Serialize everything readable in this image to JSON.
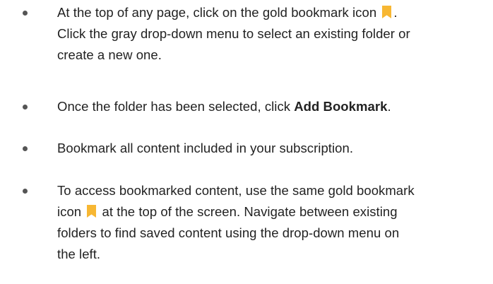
{
  "colors": {
    "bookmark_gold": "#F7B733",
    "bullet": "#555555",
    "text": "#222222"
  },
  "icons": {
    "bookmark": "bookmark-icon"
  },
  "list": {
    "item1": {
      "line1_before": "At the top of any page, click on the gold bookmark icon",
      "line1_after": ".",
      "line2": "Click the gray drop-down menu to select an existing folder or",
      "line3": "create a new one."
    },
    "item2": {
      "before": "Once the folder has been selected, click ",
      "bold": "Add Bookmark",
      "after": "."
    },
    "item3": {
      "text": "Bookmark all content included in your subscription."
    },
    "item4": {
      "line1": "To access bookmarked content, use the same gold bookmark",
      "line2_before": "icon",
      "line2_after": "at the top of the screen. Navigate between existing",
      "line3": "folders to find saved content using the drop-down menu on",
      "line4": "the left."
    }
  }
}
